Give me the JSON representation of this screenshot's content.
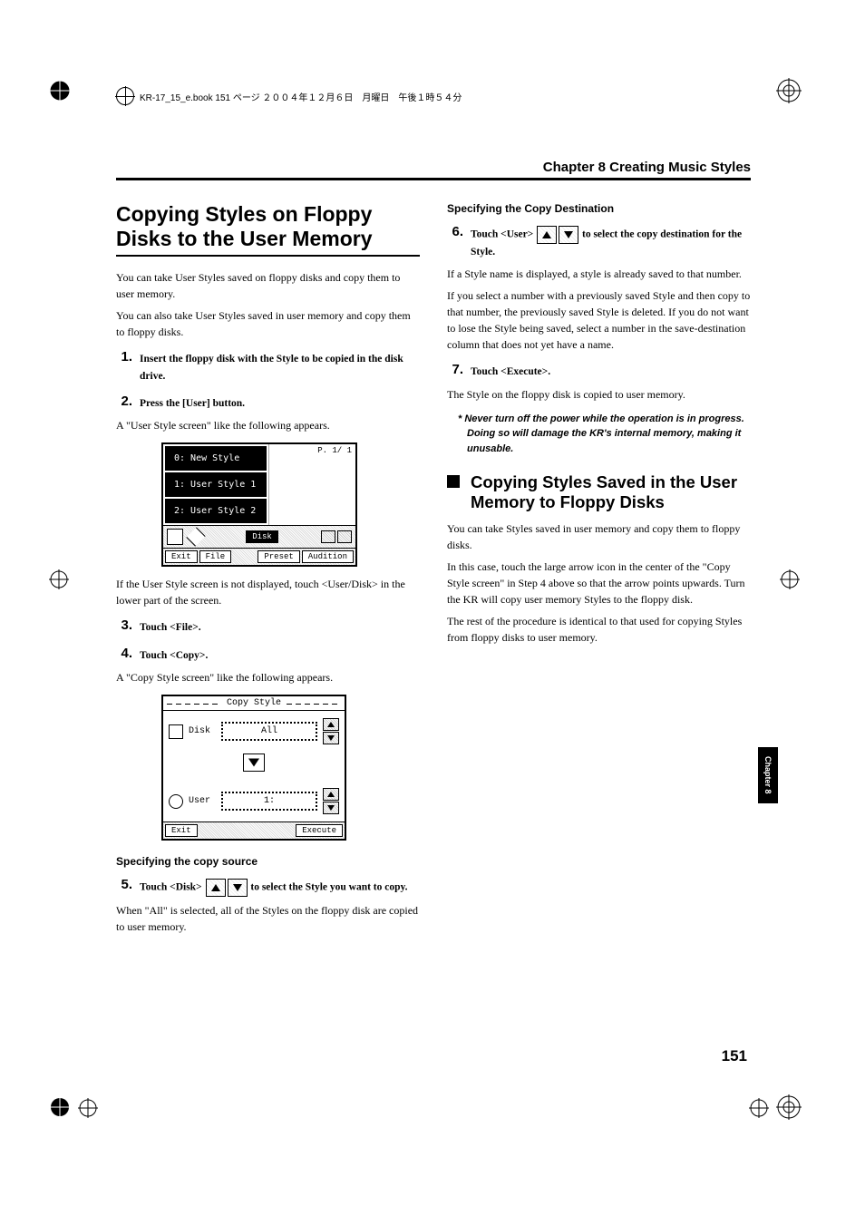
{
  "header_line": "KR-17_15_e.book  151 ページ  ２００４年１２月６日　月曜日　午後１時５４分",
  "chapter_header": "Chapter 8 Creating Music Styles",
  "side_tab": "Chapter 8",
  "page_number": "151",
  "left": {
    "title": "Copying Styles on Floppy Disks to the User Memory",
    "p1": "You can take User Styles saved on floppy disks and copy them to user memory.",
    "p2": "You can also take User Styles saved in user memory and copy them to floppy disks.",
    "step1": "Insert the floppy disk with the Style to be copied in the disk drive.",
    "step2": "Press the [User] button.",
    "step2_after": "A \"User Style screen\" like the following appears.",
    "us_screen": {
      "row0": "0: New Style",
      "row1": "1: User Style 1",
      "row2": "2: User Style 2",
      "page_ind": "P. 1/ 1",
      "disk_btn": "Disk",
      "exit": "Exit",
      "file": "File",
      "preset": "Preset",
      "audition": "Audition"
    },
    "us_after": "If the User Style screen is not displayed, touch <User/Disk> in the lower part of the screen.",
    "step3": "Touch <File>.",
    "step4": "Touch <Copy>.",
    "step4_after": "A \"Copy Style screen\" like the following appears.",
    "copy_screen": {
      "title": "Copy Style",
      "disk_label": "Disk",
      "disk_value": "All",
      "user_label": "User",
      "user_value": "1:",
      "exit": "Exit",
      "execute": "Execute"
    },
    "source_heading": "Specifying the copy source",
    "step5_pre": "Touch <Disk> ",
    "step5_post": " to select the Style you want to copy.",
    "step5_after": "When \"All\" is selected, all of the Styles on the floppy disk are copied to user memory."
  },
  "right": {
    "dest_heading": "Specifying the Copy Destination",
    "step6_pre": "Touch <User> ",
    "step6_post": " to select the copy destination for the Style.",
    "step6_p1": "If a Style name is displayed, a style is already saved to that number.",
    "step6_p2": "If you select a number with a previously saved Style and then copy to that number, the previously saved Style is deleted. If you do not want to lose the Style being saved, select a number in the save-destination column that does not yet have a name.",
    "step7": "Touch <Execute>.",
    "step7_after": "The Style on the floppy disk is copied to user memory.",
    "warning": "Never turn off the power while the operation is in progress. Doing so will damage the KR's internal memory, making it unusable.",
    "subsection": "Copying Styles Saved in the User Memory to Floppy Disks",
    "sub_p1": "You can take Styles saved in user memory and copy them to floppy disks.",
    "sub_p2": "In this case, touch the large arrow icon in the center of the \"Copy Style screen\" in Step 4 above so that the arrow points upwards. Turn the KR will copy user memory Styles to the floppy disk.",
    "sub_p3": "The rest of the procedure is identical to that used for copying Styles from floppy disks to user memory."
  }
}
